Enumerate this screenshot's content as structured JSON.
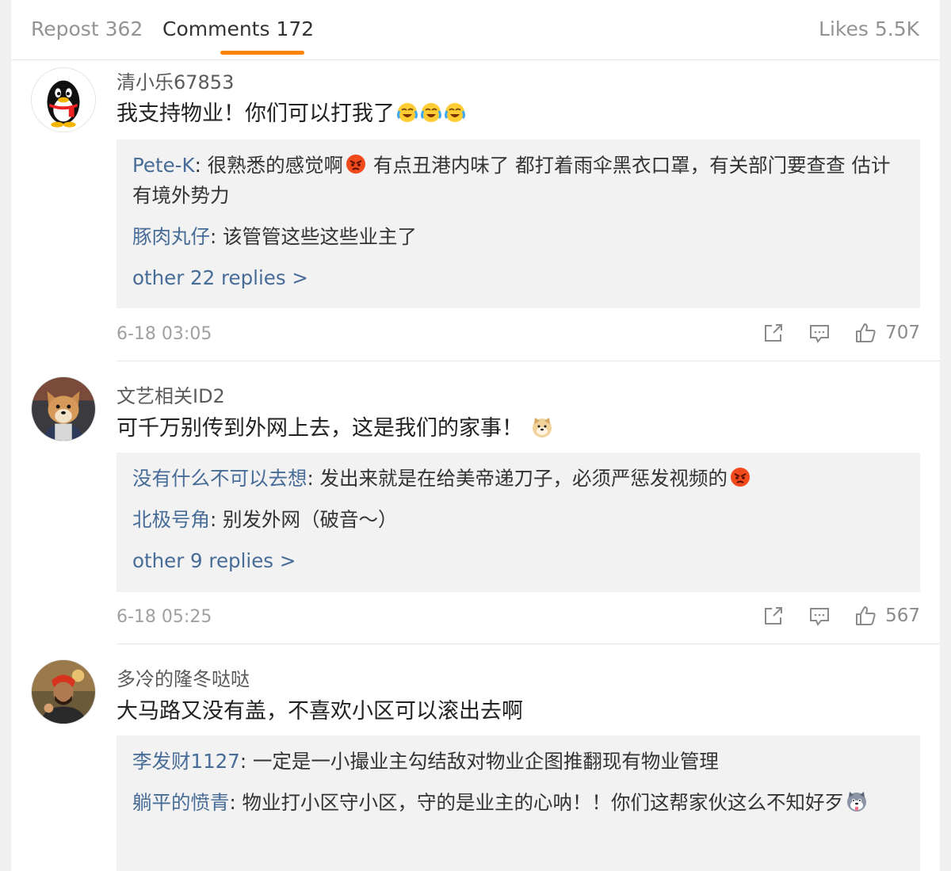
{
  "tabs": {
    "repost": "Repost 362",
    "comments": "Comments 172",
    "likes": "Likes 5.5K"
  },
  "comments": [
    {
      "username": "清小乐67853",
      "text": "我支持物业！你们可以打我了",
      "text_emojis": [
        "crying-laughing-emoji",
        "crying-laughing-emoji",
        "crying-laughing-emoji"
      ],
      "replies": [
        {
          "name": "Pete-K",
          "sep": ": ",
          "text_a": "很熟悉的感觉啊",
          "emoji": "angry-emoji",
          "text_b": " 有点丑港内味了 都打着雨伞黑衣口罩，有关部门要查查 估计有境外势力"
        },
        {
          "name": "豚肉丸仔",
          "sep": ": ",
          "text_a": "该管管这些这些业主了"
        }
      ],
      "more": "other 22 replies >",
      "time": "6-18 03:05",
      "likes": "707",
      "avatar": "qq-penguin"
    },
    {
      "username": "文艺相关ID2",
      "text": "可千万别传到外网上去，这是我们的家事！",
      "text_emojis": [
        "doge-emoji"
      ],
      "replies": [
        {
          "name": "没有什么不可以去想",
          "sep": ": ",
          "text_a": "发出来就是在给美帝递刀子，必须严惩发视频的",
          "emoji": "angry-emoji"
        },
        {
          "name": "北极号角",
          "sep": ": ",
          "text_a": "别发外网（破音～）"
        }
      ],
      "more": "other 9 replies >",
      "time": "6-18 05:25",
      "likes": "567",
      "avatar": "shiba-dog"
    },
    {
      "username": "多冷的隆冬哒哒",
      "text": "大马路又没有盖，不喜欢小区可以滚出去啊",
      "replies": [
        {
          "name": "李发财1127",
          "sep": ": ",
          "text_a": "一定是一小撮业主勾结敌对物业企图推翻现有物业管理"
        },
        {
          "name": "躺平的愤青",
          "sep": ": ",
          "text_a": "物业打小区守小区，守的是业主的心呐！！你们这帮家伙这么不知好歹",
          "emoji": "husky-emoji"
        }
      ],
      "avatar": "person-photo"
    }
  ],
  "colors": {
    "accent": "#ff8200",
    "link": "#476c98",
    "reply_bg": "#f2f2f2"
  }
}
